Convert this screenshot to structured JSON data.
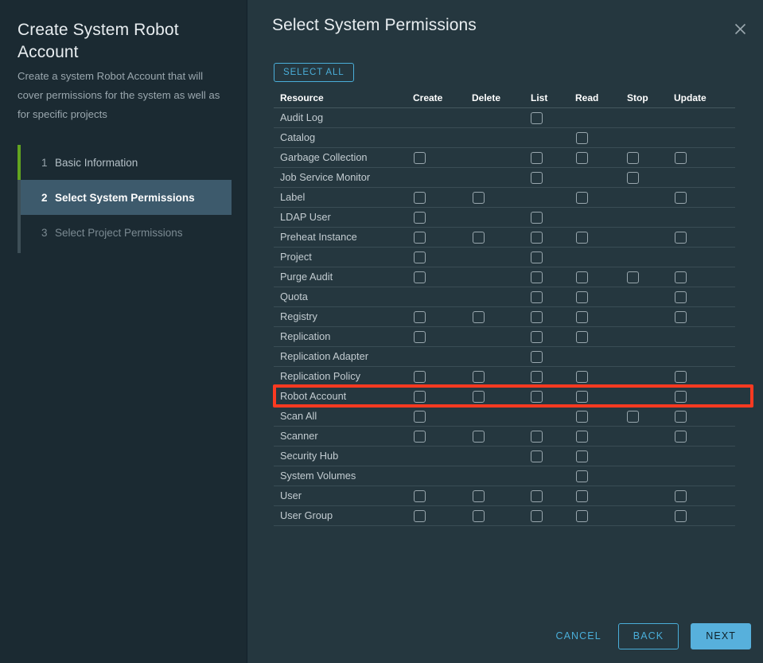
{
  "side_panel": {
    "title": "Create System Robot Account",
    "description": "Create a system Robot Account that will cover permissions for the system as well as for specific projects",
    "steps": [
      {
        "num": "1",
        "label": "Basic Information",
        "state": "done"
      },
      {
        "num": "2",
        "label": "Select System Permissions",
        "state": "active"
      },
      {
        "num": "3",
        "label": "Select Project Permissions",
        "state": "pending"
      }
    ]
  },
  "content": {
    "title": "Select System Permissions",
    "close_icon": "close-icon",
    "select_all_label": "SELECT ALL"
  },
  "table": {
    "columns": [
      "Resource",
      "Create",
      "Delete",
      "List",
      "Read",
      "Stop",
      "Update"
    ],
    "rows": [
      {
        "resource": "Audit Log",
        "create": false,
        "delete": false,
        "list": true,
        "read": false,
        "stop": false,
        "update": false
      },
      {
        "resource": "Catalog",
        "create": false,
        "delete": false,
        "list": false,
        "read": true,
        "stop": false,
        "update": false
      },
      {
        "resource": "Garbage Collection",
        "create": true,
        "delete": false,
        "list": true,
        "read": true,
        "stop": true,
        "update": true
      },
      {
        "resource": "Job Service Monitor",
        "create": false,
        "delete": false,
        "list": true,
        "read": false,
        "stop": true,
        "update": false
      },
      {
        "resource": "Label",
        "create": true,
        "delete": true,
        "list": false,
        "read": true,
        "stop": false,
        "update": true
      },
      {
        "resource": "LDAP User",
        "create": true,
        "delete": false,
        "list": true,
        "read": false,
        "stop": false,
        "update": false
      },
      {
        "resource": "Preheat Instance",
        "create": true,
        "delete": true,
        "list": true,
        "read": true,
        "stop": false,
        "update": true
      },
      {
        "resource": "Project",
        "create": true,
        "delete": false,
        "list": true,
        "read": false,
        "stop": false,
        "update": false
      },
      {
        "resource": "Purge Audit",
        "create": true,
        "delete": false,
        "list": true,
        "read": true,
        "stop": true,
        "update": true
      },
      {
        "resource": "Quota",
        "create": false,
        "delete": false,
        "list": true,
        "read": true,
        "stop": false,
        "update": true
      },
      {
        "resource": "Registry",
        "create": true,
        "delete": true,
        "list": true,
        "read": true,
        "stop": false,
        "update": true
      },
      {
        "resource": "Replication",
        "create": true,
        "delete": false,
        "list": true,
        "read": true,
        "stop": false,
        "update": false
      },
      {
        "resource": "Replication Adapter",
        "create": false,
        "delete": false,
        "list": true,
        "read": false,
        "stop": false,
        "update": false
      },
      {
        "resource": "Replication Policy",
        "create": true,
        "delete": true,
        "list": true,
        "read": true,
        "stop": false,
        "update": true
      },
      {
        "resource": "Robot Account",
        "create": true,
        "delete": true,
        "list": true,
        "read": true,
        "stop": false,
        "update": true
      },
      {
        "resource": "Scan All",
        "create": true,
        "delete": false,
        "list": false,
        "read": true,
        "stop": true,
        "update": true
      },
      {
        "resource": "Scanner",
        "create": true,
        "delete": true,
        "list": true,
        "read": true,
        "stop": false,
        "update": true
      },
      {
        "resource": "Security Hub",
        "create": false,
        "delete": false,
        "list": true,
        "read": true,
        "stop": false,
        "update": false
      },
      {
        "resource": "System Volumes",
        "create": false,
        "delete": false,
        "list": false,
        "read": true,
        "stop": false,
        "update": false
      },
      {
        "resource": "User",
        "create": true,
        "delete": true,
        "list": true,
        "read": true,
        "stop": false,
        "update": true
      },
      {
        "resource": "User Group",
        "create": true,
        "delete": true,
        "list": true,
        "read": true,
        "stop": false,
        "update": true
      }
    ],
    "highlighted_row": "Robot Account"
  },
  "footer": {
    "cancel_label": "CANCEL",
    "back_label": "BACK",
    "next_label": "NEXT"
  },
  "colors": {
    "panel_left_bg": "#1b2a32",
    "panel_right_bg": "#25373f",
    "accent_blue": "#4aaed9",
    "primary_button": "#57b0dc",
    "step_done_rail": "#62a420",
    "step_active_bg": "#3d5a6c",
    "highlight_red": "#fc3a21"
  }
}
